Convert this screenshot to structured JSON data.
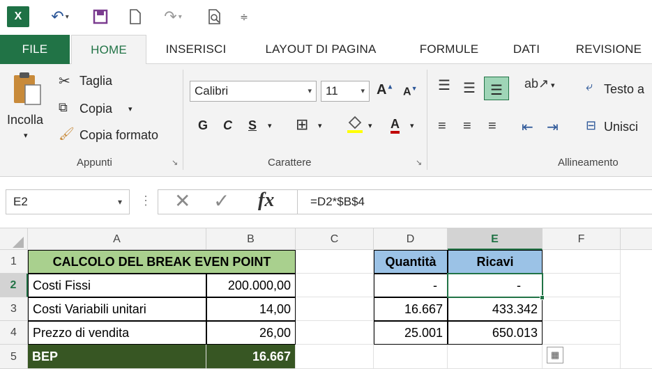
{
  "app": {
    "icon": "excel-logo"
  },
  "qat": {
    "undo_icon": "undo-icon",
    "save_icon": "save-icon",
    "new_icon": "new-document-icon",
    "redo_icon": "redo-icon",
    "preview_icon": "print-preview-icon",
    "customize_icon": "customize-qat-icon"
  },
  "tabs": [
    {
      "label": "FILE"
    },
    {
      "label": "HOME"
    },
    {
      "label": "INSERISCI"
    },
    {
      "label": "LAYOUT DI PAGINA"
    },
    {
      "label": "FORMULE"
    },
    {
      "label": "DATI"
    },
    {
      "label": "REVISIONE"
    }
  ],
  "ribbon": {
    "clipboard": {
      "paste": "Incolla",
      "cut": "Taglia",
      "copy": "Copia",
      "format_painter": "Copia formato",
      "group": "Appunti"
    },
    "font": {
      "name": "Calibri",
      "size": "11",
      "bold": "G",
      "italic": "C",
      "underline": "S",
      "color_letter": "A",
      "grow": "A",
      "shrink": "A",
      "group": "Carattere"
    },
    "alignment": {
      "wrap": "Testo a",
      "merge": "Unisci",
      "group": "Allineamento"
    }
  },
  "formula_bar": {
    "name_box": "E2",
    "cancel": "✕",
    "enter": "✓",
    "fx": "fx",
    "formula": "=D2*$B$4"
  },
  "grid": {
    "columns": [
      "A",
      "B",
      "C",
      "D",
      "E",
      "F"
    ],
    "rows": [
      "1",
      "2",
      "3",
      "4",
      "5"
    ],
    "title": "CALCOLO DEL BREAK EVEN POINT",
    "labels": [
      "Costi Fissi",
      "Costi Variabili unitari",
      "Prezzo di vendita",
      "BEP"
    ],
    "values": [
      "200.000,00",
      "14,00",
      "26,00",
      "16.667"
    ],
    "table_headers": {
      "quantity": "Quantità",
      "revenue": "Ricavi"
    },
    "quantity": [
      "-",
      "16.667",
      "25.001"
    ],
    "revenue": [
      "-",
      "433.342",
      "650.013"
    ]
  },
  "colors": {
    "accent": "#217346",
    "title_fill": "#a9d08e",
    "header_fill": "#9bc2e6",
    "bep_fill": "#375623"
  }
}
